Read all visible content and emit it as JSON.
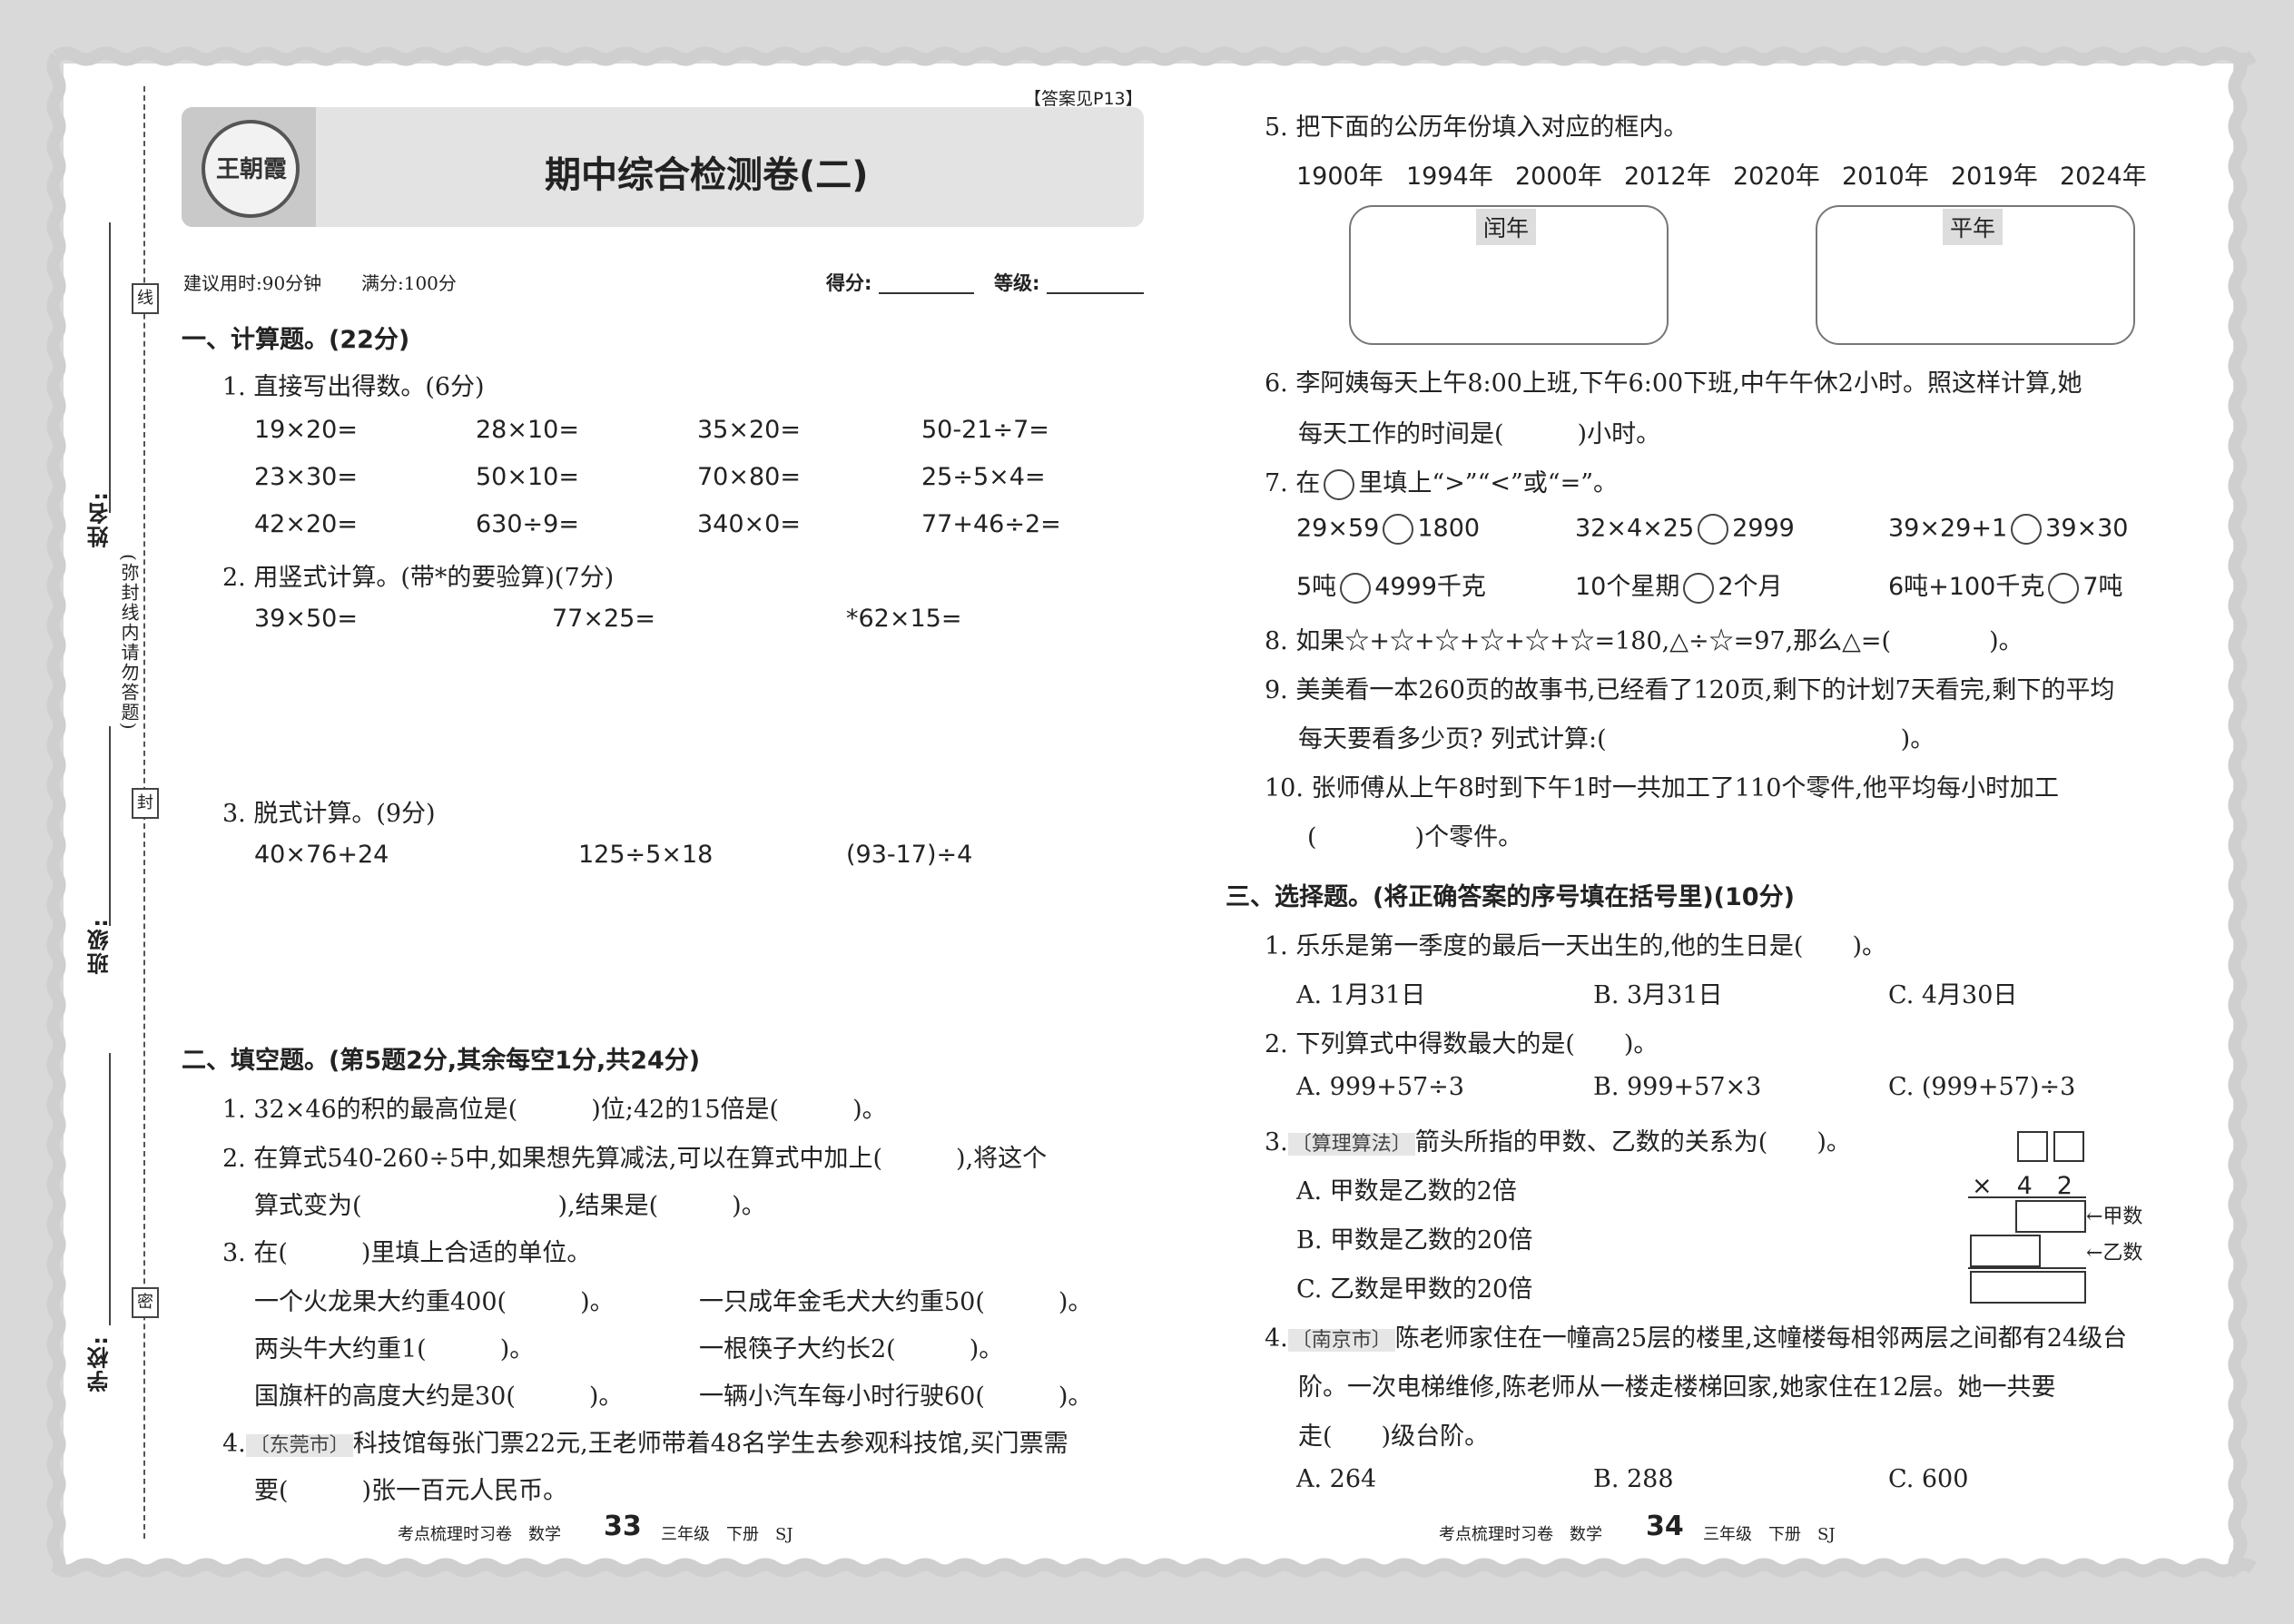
{
  "left_page": {
    "answer_ref": "【答案见P13】",
    "logo_text": "王朝霞",
    "title": "期中综合检测卷(二)",
    "meta": {
      "time": "建议用时:90分钟",
      "full_score": "满分:100分",
      "score_label": "得分:",
      "grade_label": "等级:"
    },
    "binding": {
      "xian": "线",
      "feng": "封",
      "mi": "密",
      "name": "姓名:",
      "class": "班级:",
      "school": "学校:",
      "notice": "(弥封线内请勿答题)"
    },
    "sec1": {
      "title": "一、计算题。(22分)",
      "q1": "1. 直接写出得数。(6分)",
      "grid": [
        [
          "19×20=",
          "28×10=",
          "35×20=",
          "50-21÷7="
        ],
        [
          "23×30=",
          "50×10=",
          "70×80=",
          "25÷5×4="
        ],
        [
          "42×20=",
          "630÷9=",
          "340×0=",
          "77+46÷2="
        ]
      ],
      "q2": "2. 用竖式计算。(带*的要验算)(7分)",
      "q2_items": [
        "39×50=",
        "77×25=",
        "*62×15="
      ],
      "q3": "3. 脱式计算。(9分)",
      "q3_items": [
        "40×76+24",
        "125÷5×18",
        "(93-17)÷4"
      ]
    },
    "sec2": {
      "title": "二、填空题。(第5题2分,其余每空1分,共24分)",
      "q1": "1. 32×46的积的最高位是(　　　)位;42的15倍是(　　　)。",
      "q2_a": "2. 在算式540-260÷5中,如果想先算减法,可以在算式中加上(　　　),将这个",
      "q2_b": "算式变为(　　　　　　　　),结果是(　　　)。",
      "q3": "3. 在(　　　)里填上合适的单位。",
      "q3_items": [
        [
          "一个火龙果大约重400(　　　)。",
          "一只成年金毛犬大约重50(　　　)。"
        ],
        [
          "两头牛大约重1(　　　)。",
          "一根筷子大约长2(　　　)。"
        ],
        [
          "国旗杆的高度大约是30(　　　)。",
          "一辆小汽车每小时行驶60(　　　)。"
        ]
      ],
      "q4_tag": "〔东莞市〕",
      "q4_a": "科技馆每张门票22元,王老师带着48名学生去参观科技馆,买门票需",
      "q4_b": "要(　　　)张一百元人民币。",
      "q4_num": "4."
    },
    "footer": {
      "left": "考点梳理时习卷　数学",
      "page": "33",
      "right": "三年级　下册　SJ"
    }
  },
  "right_page": {
    "q5": {
      "label": "5. 把下面的公历年份填入对应的框内。",
      "years": [
        "1900年",
        "1994年",
        "2000年",
        "2012年",
        "2020年",
        "2010年",
        "2019年",
        "2024年"
      ],
      "box1": "闰年",
      "box2": "平年"
    },
    "q6_a": "6. 李阿姨每天上午8:00上班,下午6:00下班,中午午休2小时。照这样计算,她",
    "q6_b": "每天工作的时间是(　　　)小时。",
    "q7": {
      "label": "7. 在",
      "label_b": "里填上“>”“<”或“=”。",
      "items": [
        [
          "29×59",
          "1800",
          "32×4×25",
          "2999",
          "39×29+1",
          "39×30"
        ],
        [
          "5吨",
          "4999千克",
          "10个星期",
          "2个月",
          "6吨+100千克",
          "7吨"
        ]
      ]
    },
    "q8": "8. 如果☆+☆+☆+☆+☆+☆=180,△÷☆=97,那么△=(　　　　)。",
    "q9_a": "9. 美美看一本260页的故事书,已经看了120页,剩下的计划7天看完,剩下的平均",
    "q9_b": "每天要看多少页? 列式计算:(　　　　　　　　　　　　)。",
    "q10_a": "10. 张师傅从上午8时到下午1时一共加工了110个零件,他平均每小时加工",
    "q10_b": "(　　　　)个零件。",
    "sec3": {
      "title": "三、选择题。(将正确答案的序号填在括号里)(10分)",
      "q1": "1. 乐乐是第一季度的最后一天出生的,他的生日是(　　)。",
      "q1_opts": [
        "A. 1月31日",
        "B. 3月31日",
        "C. 4月30日"
      ],
      "q2": "2. 下列算式中得数最大的是(　　)。",
      "q2_opts": [
        "A. 999+57÷3",
        "B. 999+57×3",
        "C. (999+57)÷3"
      ],
      "q3_num": "3.",
      "q3_tag": "〔算理算法〕",
      "q3": "箭头所指的甲数、乙数的关系为(　　)。",
      "q3_opts": [
        "A. 甲数是乙数的2倍",
        "B. 甲数是乙数的20倍",
        "C. 乙数是甲数的20倍"
      ],
      "q3_fig": {
        "mult": "×　4　2",
        "jia": "←甲数",
        "yi": "←乙数"
      },
      "q4_num": "4.",
      "q4_tag": "〔南京市〕",
      "q4_a": "陈老师家住在一幢高25层的楼里,这幢楼每相邻两层之间都有24级台",
      "q4_b": "阶。一次电梯维修,陈老师从一楼走楼梯回家,她家住在12层。她一共要",
      "q4_c": "走(　　)级台阶。",
      "q4_opts": [
        "A. 264",
        "B. 288",
        "C. 600"
      ]
    },
    "footer": {
      "left": "考点梳理时习卷　数学",
      "page": "34",
      "right": "三年级　下册　SJ"
    }
  }
}
